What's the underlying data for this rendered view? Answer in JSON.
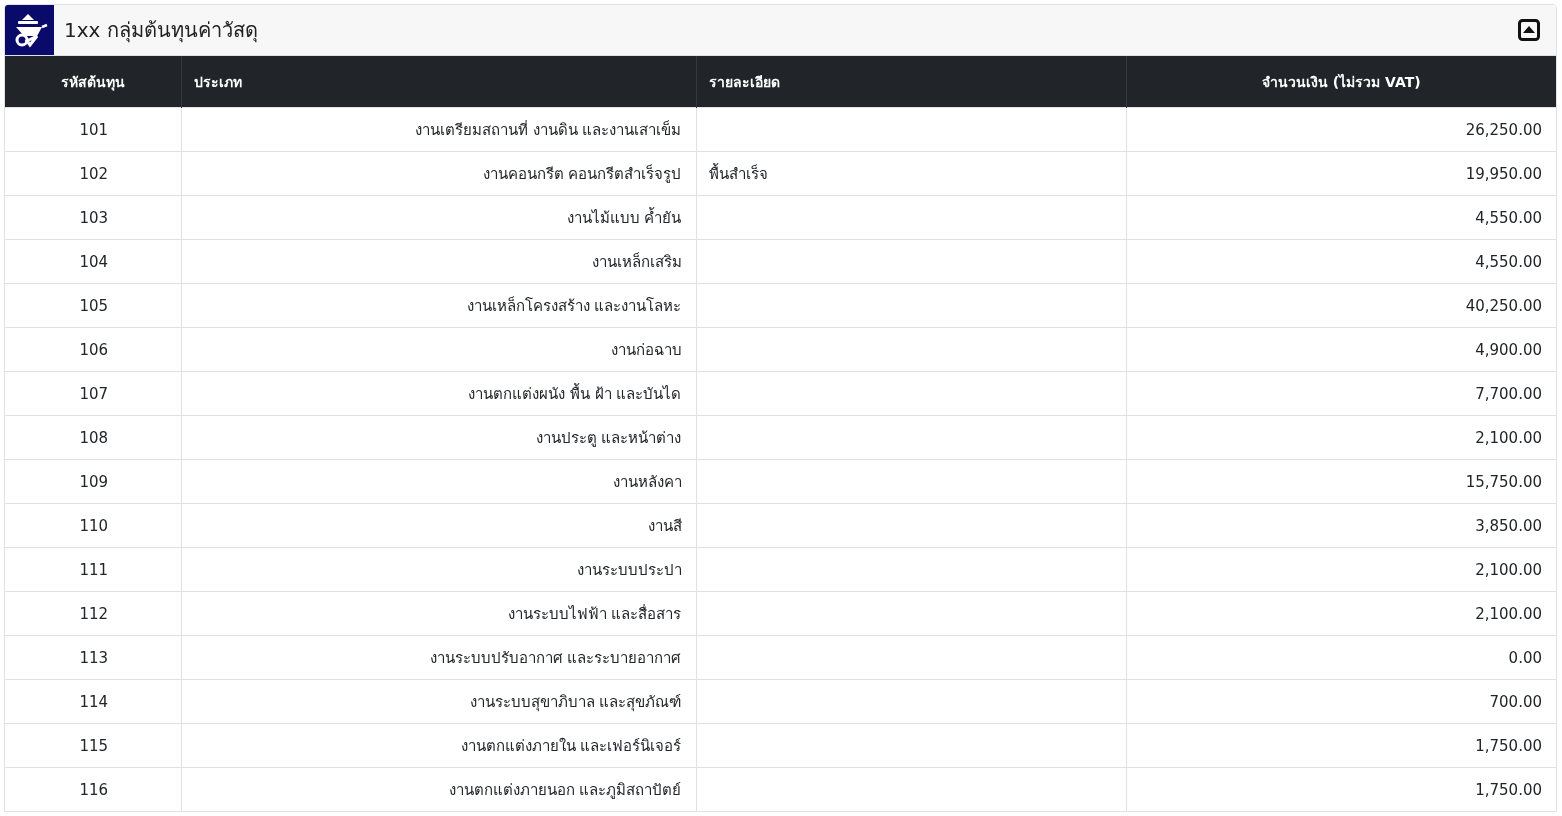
{
  "panel": {
    "title": "1xx กลุ่มต้นทุนค่าวัสดุ",
    "expanded": true
  },
  "table": {
    "columns": [
      "รหัสต้นทุน",
      "ประเภท",
      "รายละเอียด",
      "จำนวนเงิน (ไม่รวม VAT)"
    ],
    "rows": [
      {
        "code": "101",
        "type": "งานเตรียมสถานที่ งานดิน และงานเสาเข็ม",
        "detail": "",
        "amount": "26,250.00"
      },
      {
        "code": "102",
        "type": "งานคอนกรีต คอนกรีตสำเร็จรูป",
        "detail": "พื้นสำเร็จ",
        "amount": "19,950.00"
      },
      {
        "code": "103",
        "type": "งานไม้แบบ ค้ำยัน",
        "detail": "",
        "amount": "4,550.00"
      },
      {
        "code": "104",
        "type": "งานเหล็กเสริม",
        "detail": "",
        "amount": "4,550.00"
      },
      {
        "code": "105",
        "type": "งานเหล็กโครงสร้าง และงานโลหะ",
        "detail": "",
        "amount": "40,250.00"
      },
      {
        "code": "106",
        "type": "งานก่อฉาบ",
        "detail": "",
        "amount": "4,900.00"
      },
      {
        "code": "107",
        "type": "งานตกแต่งผนัง พื้น ฝ้า และบันได",
        "detail": "",
        "amount": "7,700.00"
      },
      {
        "code": "108",
        "type": "งานประตู และหน้าต่าง",
        "detail": "",
        "amount": "2,100.00"
      },
      {
        "code": "109",
        "type": "งานหลังคา",
        "detail": "",
        "amount": "15,750.00"
      },
      {
        "code": "110",
        "type": "งานสี",
        "detail": "",
        "amount": "3,850.00"
      },
      {
        "code": "111",
        "type": "งานระบบประปา",
        "detail": "",
        "amount": "2,100.00"
      },
      {
        "code": "112",
        "type": "งานระบบไฟฟ้า และสื่อสาร",
        "detail": "",
        "amount": "2,100.00"
      },
      {
        "code": "113",
        "type": "งานระบบปรับอากาศ และระบายอากาศ",
        "detail": "",
        "amount": "0.00"
      },
      {
        "code": "114",
        "type": "งานระบบสุขาภิบาล และสุขภัณฑ์",
        "detail": "",
        "amount": "700.00"
      },
      {
        "code": "115",
        "type": "งานตกแต่งภายใน และเฟอร์นิเจอร์",
        "detail": "",
        "amount": "1,750.00"
      },
      {
        "code": "116",
        "type": "งานตกแต่งภายนอก และภูมิสถาปัตย์",
        "detail": "",
        "amount": "1,750.00"
      }
    ]
  }
}
